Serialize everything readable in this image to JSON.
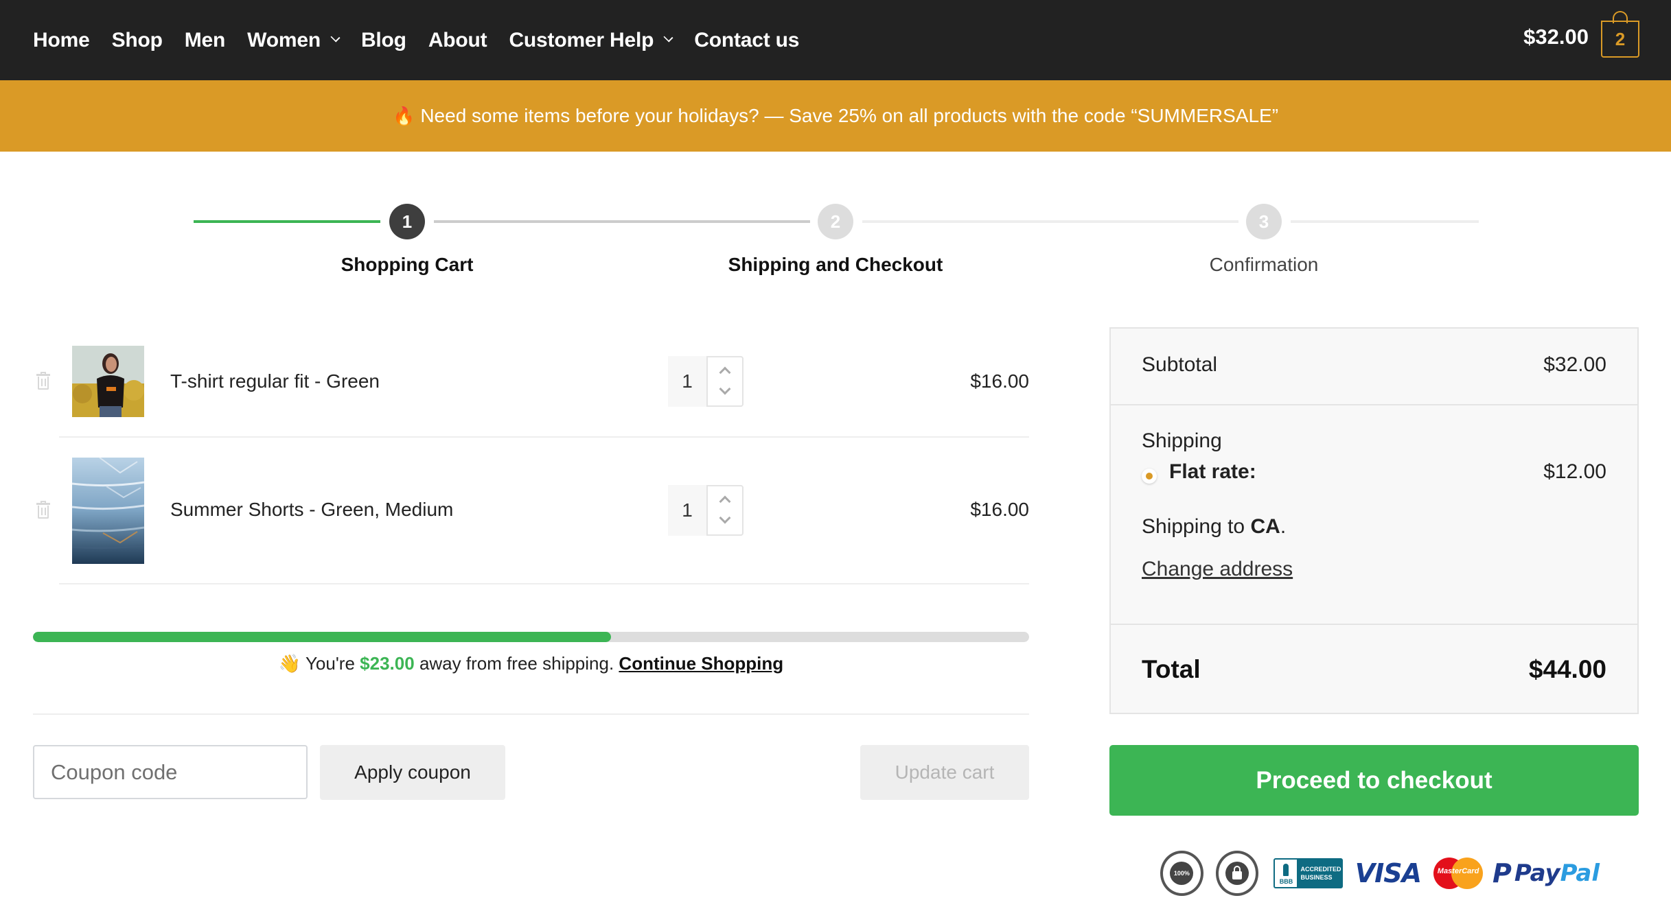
{
  "nav": {
    "links": [
      {
        "label": "Home",
        "has_dropdown": false
      },
      {
        "label": "Shop",
        "has_dropdown": false
      },
      {
        "label": "Men",
        "has_dropdown": false
      },
      {
        "label": "Women",
        "has_dropdown": true
      },
      {
        "label": "Blog",
        "has_dropdown": false
      },
      {
        "label": "About",
        "has_dropdown": false
      },
      {
        "label": "Customer Help",
        "has_dropdown": true
      },
      {
        "label": "Contact us",
        "has_dropdown": false
      }
    ],
    "cart_total": "$32.00",
    "cart_count": "2",
    "cart_icon": "shopping-bag-icon"
  },
  "banner": {
    "icon": "fire-icon",
    "emoji": "🔥",
    "text": "Need some items before your holidays? — Save 25% on all products with the code “SUMMERSALE”"
  },
  "steps": [
    {
      "number": "1",
      "label": "Shopping Cart",
      "state": "active"
    },
    {
      "number": "2",
      "label": "Shipping and Checkout",
      "state": "upcoming"
    },
    {
      "number": "3",
      "label": "Confirmation",
      "state": "upcoming"
    }
  ],
  "cart": {
    "items": [
      {
        "name": "T-shirt regular fit - Green",
        "quantity": "1",
        "price": "$16.00",
        "image": "woman-in-black-tshirt-photo"
      },
      {
        "name": "Summer Shorts - Green, Medium",
        "quantity": "1",
        "price": "$16.00",
        "image": "stacked-denim-photo"
      }
    ],
    "free_shipping": {
      "progress_percent": 58,
      "emoji": "👋",
      "prefix": "You're",
      "amount": "$23.00",
      "suffix": "away from free shipping.",
      "link": "Continue Shopping"
    },
    "coupon_placeholder": "Coupon code",
    "coupon_value": "",
    "apply_coupon_label": "Apply coupon",
    "update_cart_label": "Update cart"
  },
  "summary": {
    "subtotal_label": "Subtotal",
    "subtotal_value": "$32.00",
    "shipping_label": "Shipping",
    "shipping_method": "Flat rate:",
    "shipping_cost": "$12.00",
    "shipping_to_prefix": "Shipping to",
    "shipping_to_region": "CA",
    "shipping_to_suffix": ".",
    "change_address": "Change address",
    "total_label": "Total",
    "total_value": "$44.00",
    "checkout_label": "Proceed to checkout"
  },
  "trust_badges": {
    "satisfaction": "100%",
    "bbb_line1": "ACCREDITED",
    "bbb_line2": "BUSINESS",
    "bbb_logo": "BBB",
    "visa": "VISA",
    "mastercard": "MasterCard",
    "paypal_pay": "Pay",
    "paypal_pal": "Pal"
  },
  "colors": {
    "nav_bg": "#222222",
    "accent": "#DA9A26",
    "success": "#3CB554",
    "step_active": "#3E3E3E",
    "step_inactive": "#DDDDDD"
  }
}
